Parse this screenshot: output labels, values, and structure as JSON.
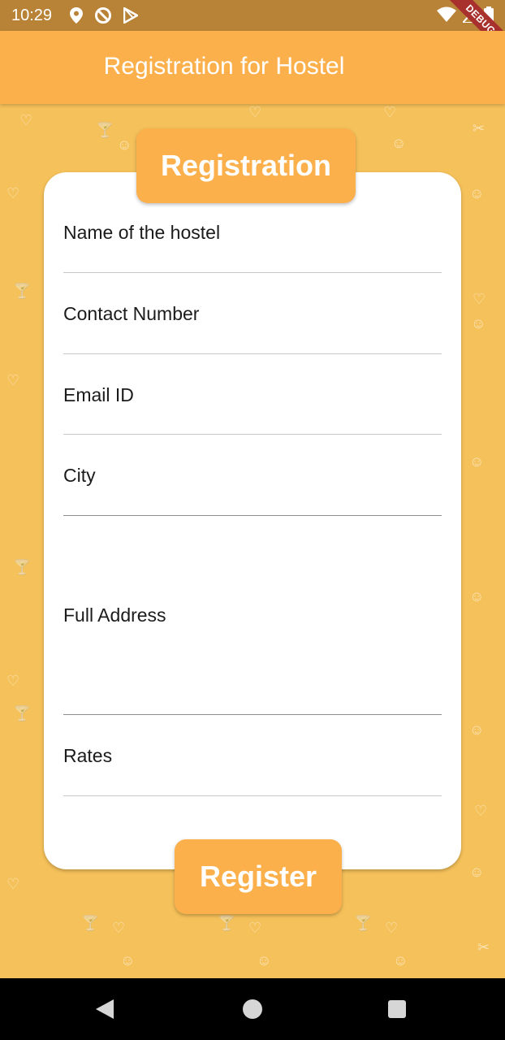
{
  "status_bar": {
    "time": "10:29",
    "left_icons": [
      "location-icon",
      "no-disturb-icon",
      "play-store-icon"
    ],
    "right_icons": [
      "wifi-icon",
      "signal-icon",
      "battery-icon"
    ]
  },
  "debug_banner": "DEBUG",
  "app_bar": {
    "title": "Registration for Hostel"
  },
  "card": {
    "badge": "Registration",
    "fields": [
      {
        "label": "Name of the hostel"
      },
      {
        "label": "Contact Number"
      },
      {
        "label": "Email ID"
      },
      {
        "label": "City"
      },
      {
        "label": "Full Address"
      },
      {
        "label": "Rates"
      }
    ]
  },
  "register_button": {
    "label": "Register"
  },
  "nav_bar": {
    "icons": [
      "back-icon",
      "home-icon",
      "recents-icon"
    ]
  },
  "colors": {
    "background": "#f5c15a",
    "accent": "#fbb04b",
    "status_bar": "#b98337",
    "card": "#ffffff"
  }
}
